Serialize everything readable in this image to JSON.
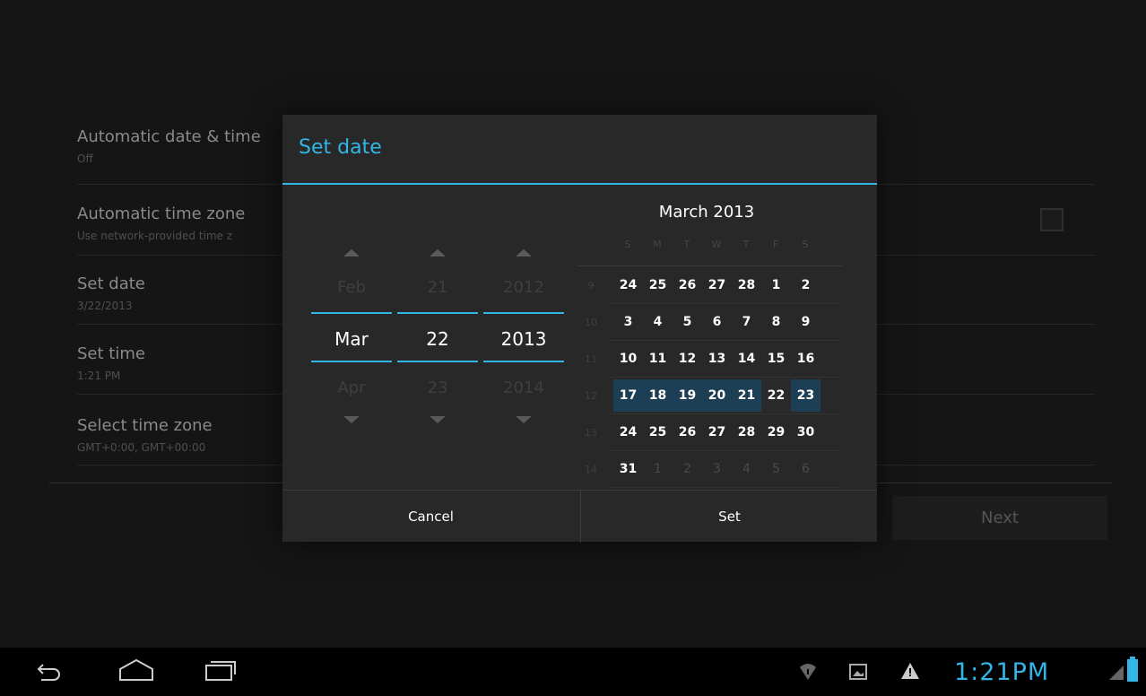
{
  "settings": {
    "items": [
      {
        "title": "Automatic date & time",
        "summary": "Off"
      },
      {
        "title": "Automatic time zone",
        "summary": "Use network-provided time z"
      },
      {
        "title": "Set date",
        "summary": "3/22/2013"
      },
      {
        "title": "Set time",
        "summary": "1:21 PM"
      },
      {
        "title": "Select time zone",
        "summary": "GMT+0:00, GMT+00:00"
      }
    ],
    "next_label": "Next"
  },
  "dialog": {
    "title": "Set date",
    "pickers": {
      "month": {
        "prev": "Feb",
        "current": "Mar",
        "next": "Apr"
      },
      "day": {
        "prev": "21",
        "current": "22",
        "next": "23"
      },
      "year": {
        "prev": "2012",
        "current": "2013",
        "next": "2014"
      }
    },
    "calendar": {
      "title": "March 2013",
      "weekdays": [
        "S",
        "M",
        "T",
        "W",
        "T",
        "F",
        "S"
      ],
      "weeks": [
        {
          "num": "9",
          "days": [
            "24",
            "25",
            "26",
            "27",
            "28",
            "1",
            "2"
          ]
        },
        {
          "num": "10",
          "days": [
            "3",
            "4",
            "5",
            "6",
            "7",
            "8",
            "9"
          ]
        },
        {
          "num": "11",
          "days": [
            "10",
            "11",
            "12",
            "13",
            "14",
            "15",
            "16"
          ]
        },
        {
          "num": "12",
          "days": [
            "17",
            "18",
            "19",
            "20",
            "21",
            "22",
            "23"
          ]
        },
        {
          "num": "13",
          "days": [
            "24",
            "25",
            "26",
            "27",
            "28",
            "29",
            "30"
          ]
        },
        {
          "num": "14",
          "days": [
            "31",
            "1",
            "2",
            "3",
            "4",
            "5",
            "6"
          ]
        }
      ],
      "selected_day": "22"
    },
    "cancel_label": "Cancel",
    "set_label": "Set"
  },
  "statusbar": {
    "time": "1:21PM"
  },
  "colors": {
    "accent": "#33b5e5",
    "dialog_bg": "#282828",
    "screen_bg": "#151515"
  }
}
